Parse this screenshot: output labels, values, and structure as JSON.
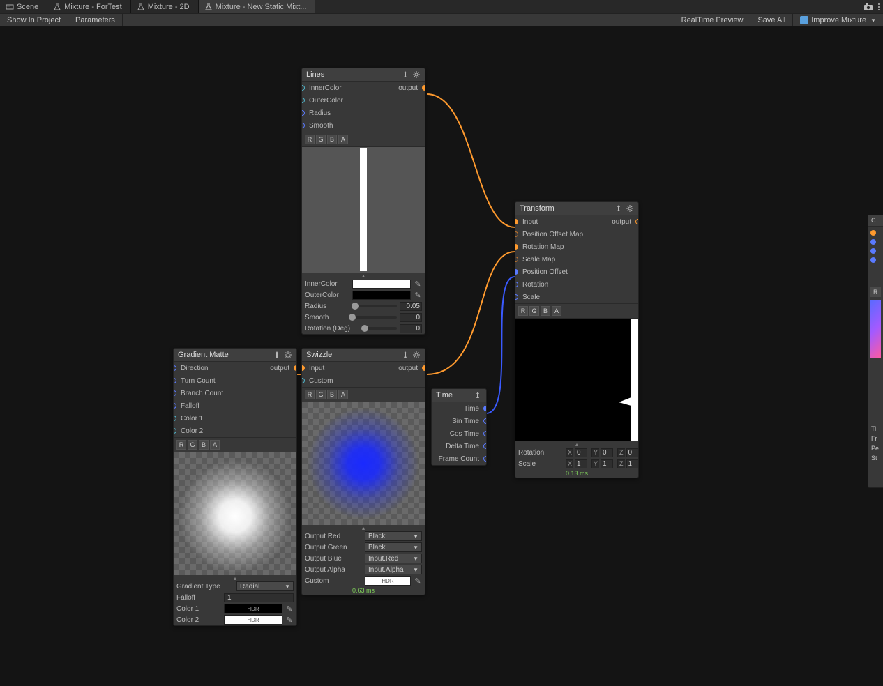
{
  "tabs": [
    {
      "label": "Scene"
    },
    {
      "label": "Mixture - ForTest"
    },
    {
      "label": "Mixture - 2D"
    },
    {
      "label": "Mixture - New Static Mixt..."
    }
  ],
  "toolbar": {
    "show_in_project": "Show In Project",
    "parameters": "Parameters",
    "realtime_preview": "RealTime Preview",
    "save_all": "Save All",
    "improve_mixture": "Improve Mixture"
  },
  "rgba": [
    "R",
    "G",
    "B",
    "A"
  ],
  "nodes": {
    "lines": {
      "title": "Lines",
      "ports_in": [
        "InnerColor",
        "OuterColor",
        "Radius",
        "Smooth"
      ],
      "output_label": "output",
      "fields": {
        "inner": "InnerColor",
        "outer": "OuterColor",
        "radius_label": "Radius",
        "radius_val": "0.05",
        "smooth_label": "Smooth",
        "smooth_val": "0",
        "rotation_label": "Rotation (Deg)",
        "rotation_val": "0"
      }
    },
    "gradient": {
      "title": "Gradient Matte",
      "ports_in": [
        "Direction",
        "Turn Count",
        "Branch Count",
        "Falloff",
        "Color 1",
        "Color 2"
      ],
      "output_label": "output",
      "fields": {
        "type_label": "Gradient Type",
        "type_val": "Radial",
        "falloff_label": "Falloff",
        "falloff_val": "1",
        "color1_label": "Color 1",
        "color2_label": "Color 2",
        "hdr": "HDR"
      }
    },
    "swizzle": {
      "title": "Swizzle",
      "ports_in": [
        "Input",
        "Custom"
      ],
      "output_label": "output",
      "fields": {
        "red_label": "Output Red",
        "red_val": "Black",
        "green_label": "Output Green",
        "green_val": "Black",
        "blue_label": "Output Blue",
        "blue_val": "Input.Red",
        "alpha_label": "Output Alpha",
        "alpha_val": "Input.Alpha",
        "custom_label": "Custom",
        "hdr": "HDR"
      },
      "perf": "0.63 ms"
    },
    "time": {
      "title": "Time",
      "outs": [
        "Time",
        "Sin Time",
        "Cos Time",
        "Delta Time",
        "Frame Count"
      ]
    },
    "transform": {
      "title": "Transform",
      "ports_in": [
        "Input",
        "Position Offset Map",
        "Rotation Map",
        "Scale Map",
        "Position Offset",
        "Rotation",
        "Scale"
      ],
      "output_label": "output",
      "fields": {
        "rotation_label": "Rotation",
        "scale_label": "Scale",
        "x": "X",
        "y": "Y",
        "z": "Z",
        "rx": "0",
        "ry": "0",
        "rz": "0",
        "sx": "1",
        "sy": "1",
        "sz": "1"
      },
      "perf": "0.13 ms"
    },
    "right_edge": {
      "hdr": "C",
      "labels": [
        "Ti",
        "Fr",
        "Pe",
        "St"
      ],
      "r": "R"
    }
  }
}
